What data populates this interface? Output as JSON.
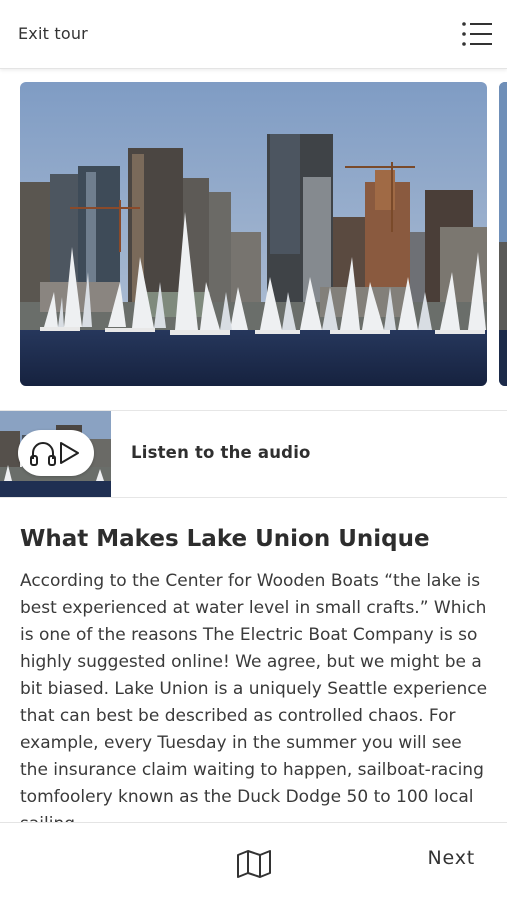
{
  "header": {
    "exit_label": "Exit tour",
    "menu_icon": "menu-list-icon"
  },
  "carousel": {
    "images": [
      {
        "description_icon": "lake-union-photo",
        "active": true
      },
      {
        "description_icon": "next-photo-preview",
        "active": false
      }
    ]
  },
  "audio": {
    "label": "Listen to the audio",
    "icons": [
      "headphones-icon",
      "play-icon"
    ]
  },
  "article": {
    "title": "What Makes Lake Union Unique",
    "body": "According to the Center for Wooden Boats “the lake is best experienced at water level in small crafts.” Which is one of the reasons The Electric Boat Company is so highly suggested online! We agree, but we might be a bit biased. Lake Union is a uniquely Seattle experience that can best be described as controlled chaos. For example, every Tuesday in the summer you will see the insurance claim waiting to happen, sailboat-racing tomfoolery known as the Duck Dodge 50 to 100 local sailing"
  },
  "footer": {
    "map_icon": "map-icon",
    "next_label": "Next"
  },
  "colors": {
    "sky": "#8fa6c4",
    "water": "#1f2f52",
    "text": "#3a3a3a"
  }
}
